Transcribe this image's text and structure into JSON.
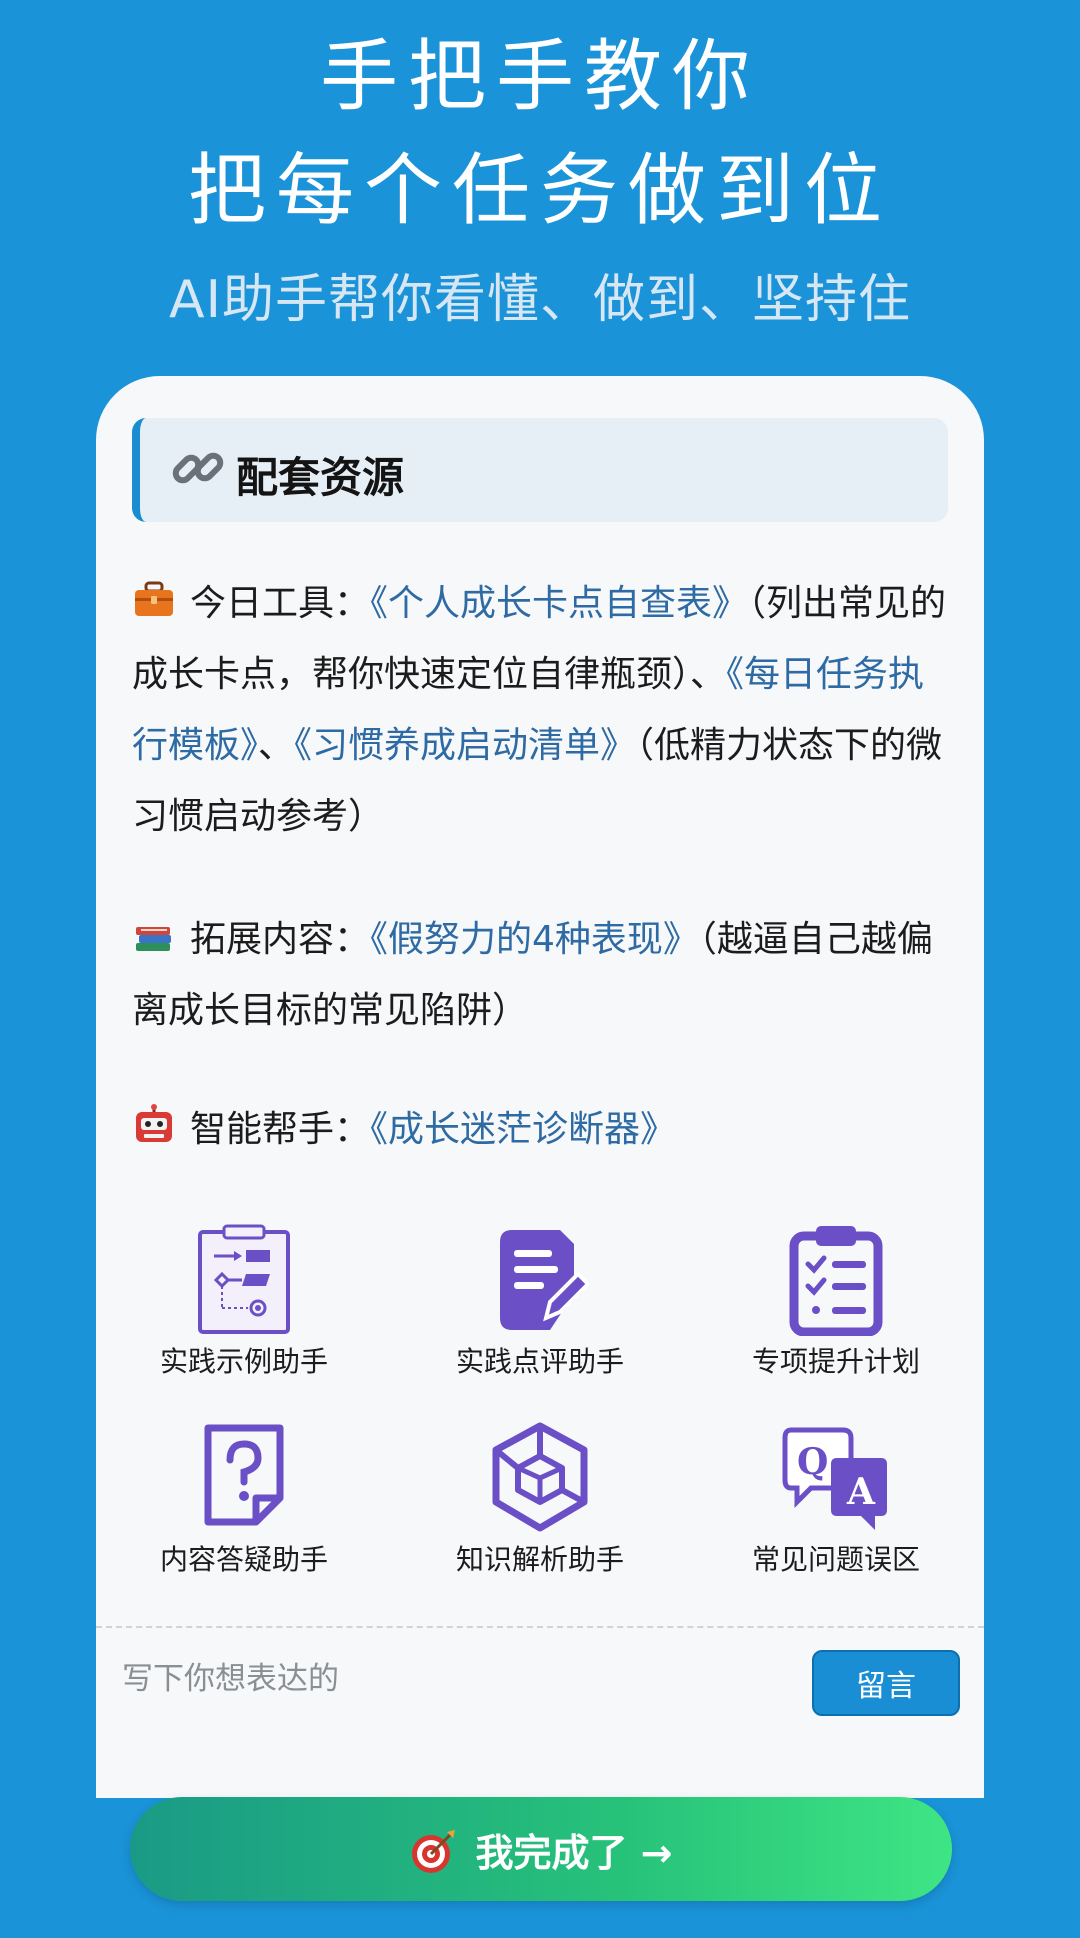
{
  "hero": {
    "title_line1": "手把手教你",
    "title_line2": "把每个任务做到位",
    "subtitle": "AI助手帮你看懂、做到、坚持住"
  },
  "resources": {
    "header_icon": "link-icon",
    "header_title": "配套资源",
    "tools": {
      "icon": "toolbox-icon",
      "label": "今日工具：",
      "link1": "《个人成长卡点自查表》",
      "desc1": "（列出常见的成长卡点，帮你快速定位自律瓶颈）、",
      "link2": "《每日任务执行模板》",
      "sep": "、",
      "link3": "《习惯养成启动清单》",
      "desc3": "（低精力状态下的微习惯启动参考）"
    },
    "extended": {
      "icon": "books-icon",
      "label": "拓展内容：",
      "link1": "《假努力的4种表现》",
      "desc1": "（越逼自己越偏离成长目标的常见陷阱）"
    },
    "assistant": {
      "icon": "robot-icon",
      "label": "智能帮手：",
      "link1": "《成长迷茫诊断器》"
    }
  },
  "tools_grid": [
    {
      "label": "实践示例助手",
      "icon": "flowchart-clipboard-icon"
    },
    {
      "label": "实践点评助手",
      "icon": "document-edit-icon"
    },
    {
      "label": "专项提升计划",
      "icon": "checklist-clipboard-icon"
    },
    {
      "label": "内容答疑助手",
      "icon": "question-note-icon"
    },
    {
      "label": "知识解析助手",
      "icon": "cube-icon"
    },
    {
      "label": "常见问题误区",
      "icon": "qa-bubbles-icon"
    }
  ],
  "comment": {
    "placeholder": "写下你想表达的",
    "button": "留言"
  },
  "done_button": {
    "icon": "target-icon",
    "label": "我完成了 →"
  },
  "colors": {
    "background": "#1a93d8",
    "link": "#2e6aa3",
    "icon_purple": "#6a4fc6",
    "button_blue": "#1a8ed4"
  }
}
